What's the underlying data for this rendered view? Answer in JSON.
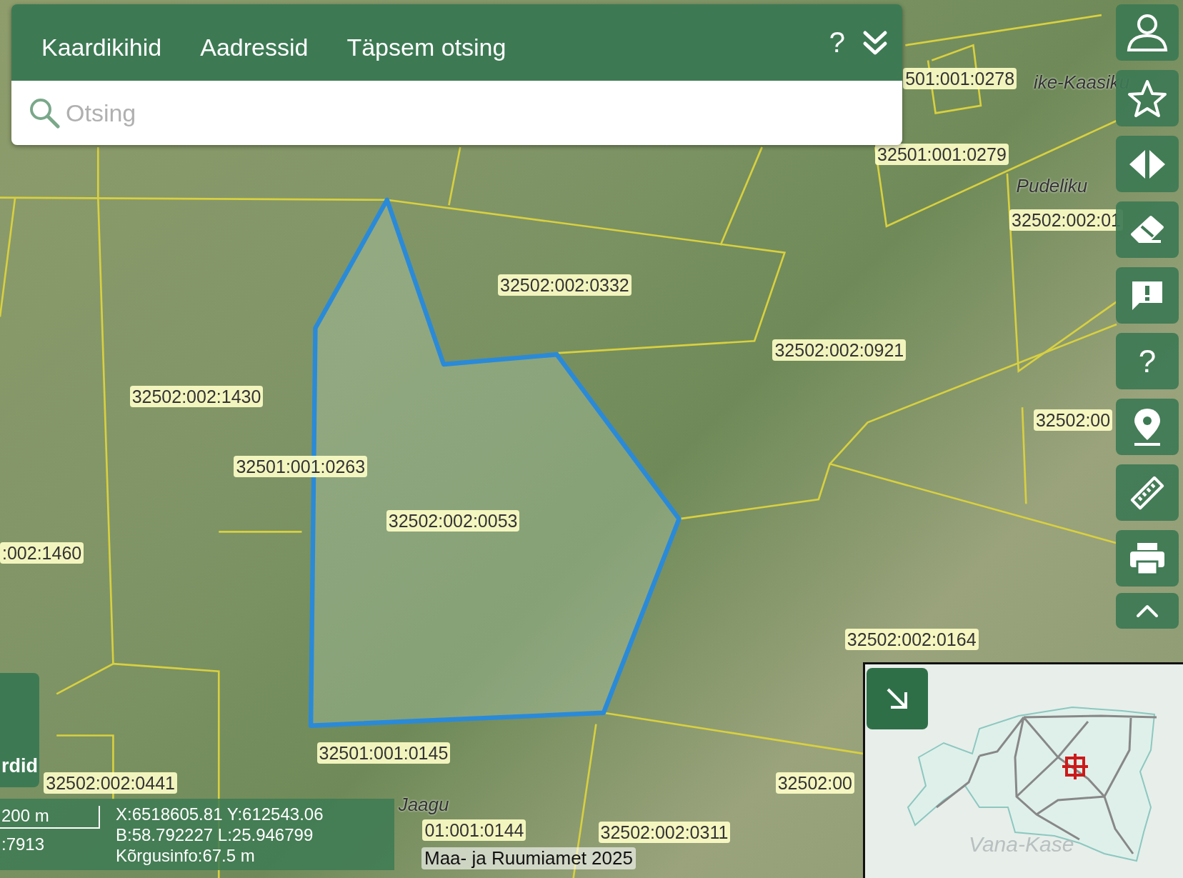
{
  "search_panel": {
    "tabs": [
      {
        "label": "Kaardikihid"
      },
      {
        "label": "Aadressid"
      },
      {
        "label": "Täpsem otsing"
      }
    ],
    "help_label": "?",
    "search": {
      "placeholder": "Otsing"
    }
  },
  "toolbar": {
    "help_label": "?"
  },
  "map": {
    "parcel_labels": [
      "501:001:0278",
      "32501:001:0279",
      "32502:002:01",
      "32502:002:0332",
      "32502:002:0921",
      "32502:002:1430",
      "32502:00",
      "32501:001:0263",
      "32502:002:0053",
      ":002:1460",
      "32502:002:0164",
      "32501:001:0145",
      "32502:002:0441",
      "32502:00",
      "32502:002:0311",
      "01:001:0144"
    ],
    "place_names": [
      "ike-Kaasiku",
      "Pudeliku",
      "Jaagu"
    ],
    "attribution": "Maa- ja Ruumiamet 2025"
  },
  "side_tab": {
    "label": "rdid"
  },
  "scale": {
    "distance": "200 m",
    "ratio": ":7913"
  },
  "coordinates": [
    "X:6518605.81 Y:612543.06",
    "B:58.792227 L:25.946799",
    "Kõrgusinfo:67.5 m"
  ],
  "overview_map": {
    "place_name": "Vana-Kase"
  }
}
